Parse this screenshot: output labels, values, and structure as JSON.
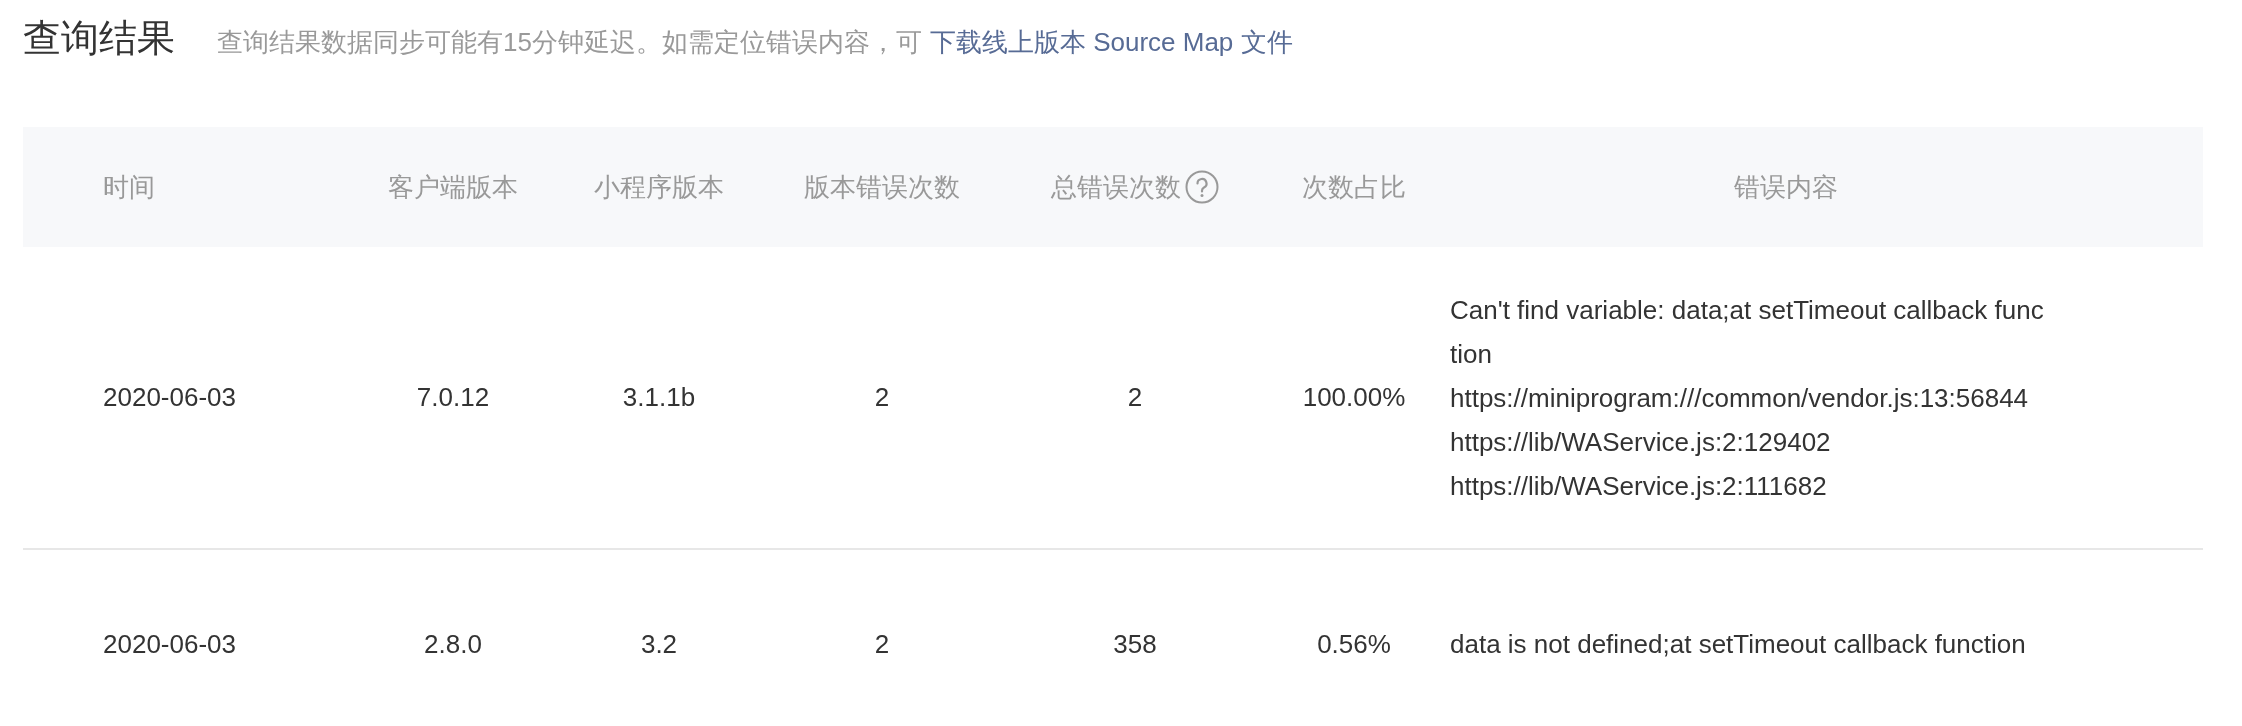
{
  "title": "查询结果",
  "notice": {
    "text": "查询结果数据同步可能有15分钟延迟。如需定位错误内容，可",
    "link": "下载线上版本 Source Map 文件"
  },
  "table": {
    "columns": [
      {
        "label": "时间",
        "help": false
      },
      {
        "label": "客户端版本",
        "help": false
      },
      {
        "label": "小程序版本",
        "help": false
      },
      {
        "label": "版本错误次数",
        "help": false
      },
      {
        "label": "总错误次数",
        "help": true
      },
      {
        "label": "次数占比",
        "help": false
      },
      {
        "label": "错误内容",
        "help": false
      }
    ],
    "rows": [
      {
        "time": "2020-06-03",
        "client_version": "7.0.12",
        "app_version": "3.1.1b",
        "version_errors": "2",
        "total_errors": "2",
        "ratio": "100.00%",
        "error_lines": [
          "Can't find variable: data;at setTimeout callback func",
          "tion",
          "https://miniprogram:///common/vendor.js:13:56844",
          "https://lib/WAService.js:2:129402",
          "https://lib/WAService.js:2:111682"
        ]
      },
      {
        "time": "2020-06-03",
        "client_version": "2.8.0",
        "app_version": "3.2",
        "version_errors": "2",
        "total_errors": "358",
        "ratio": "0.56%",
        "error_lines": [
          "data is not defined;at setTimeout callback function"
        ]
      }
    ]
  }
}
